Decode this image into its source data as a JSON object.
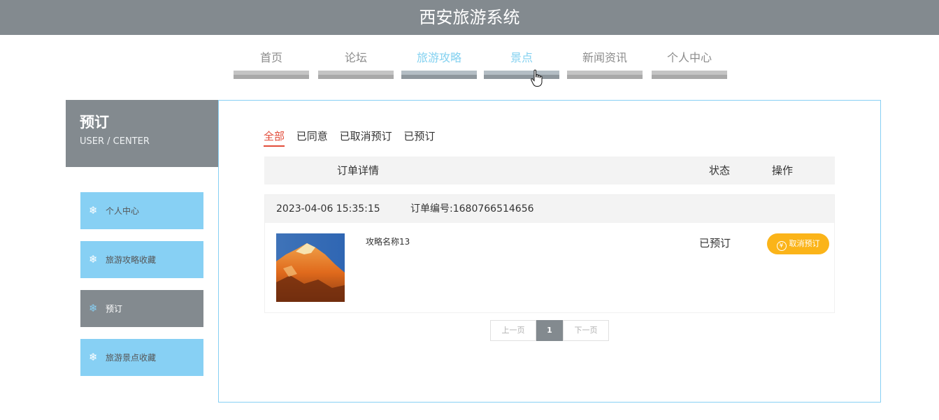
{
  "header": {
    "title": "西安旅游系统"
  },
  "nav": {
    "items": [
      {
        "label": "首页"
      },
      {
        "label": "论坛"
      },
      {
        "label": "旅游攻略"
      },
      {
        "label": "景点"
      },
      {
        "label": "新闻资讯"
      },
      {
        "label": "个人中心"
      }
    ]
  },
  "sidebar": {
    "title": "预订",
    "subtitle": "USER / CENTER",
    "icon": "snowflake-icon",
    "items": [
      {
        "label": "个人中心"
      },
      {
        "label": "旅游攻略收藏"
      },
      {
        "label": "预订"
      },
      {
        "label": "旅游景点收藏"
      }
    ]
  },
  "tabs": [
    {
      "label": "全部"
    },
    {
      "label": "已同意"
    },
    {
      "label": "已取消预订"
    },
    {
      "label": "已预订"
    }
  ],
  "table": {
    "headers": {
      "detail": "订单详情",
      "status": "状态",
      "action": "操作"
    }
  },
  "orders": [
    {
      "date": "2023-04-06 15:35:15",
      "number": "订单编号:1680766514656",
      "name": "攻略名称13",
      "status": "已预订",
      "action_label": "取消预订",
      "action_icon": "yen-icon"
    }
  ],
  "pager": {
    "prev": "上一页",
    "current": "1",
    "next": "下一页"
  },
  "colors": {
    "header": "#838a8f",
    "accent": "#87d0f4",
    "tab_active": "#e24c3a",
    "button": "#fbb419"
  }
}
